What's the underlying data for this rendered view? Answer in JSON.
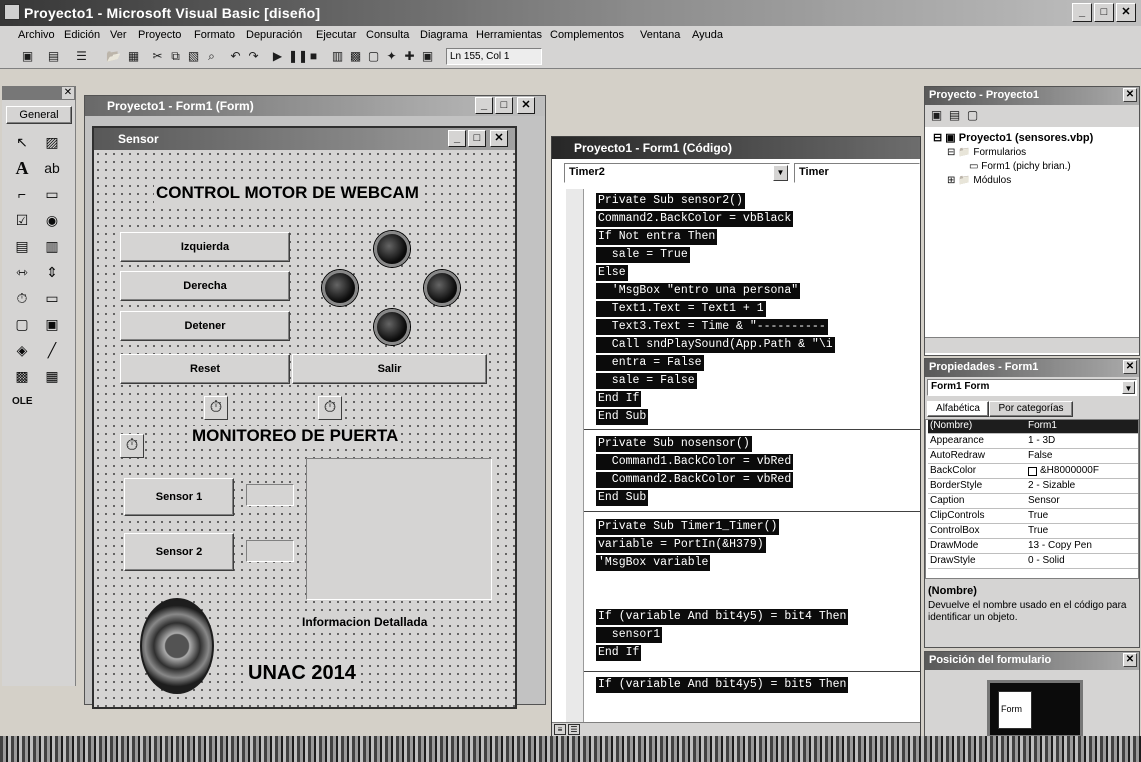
{
  "window": {
    "title": "Proyecto1 - Microsoft Visual Basic [diseño]"
  },
  "menu": [
    "Archivo",
    "Edición",
    "Ver",
    "Proyecto",
    "Formato",
    "Depuración",
    "Ejecutar",
    "Consulta",
    "Diagrama",
    "Herramientas",
    "Complementos",
    "Ventana",
    "Ayuda"
  ],
  "toolbar": {
    "position": "Ln 155, Col 1"
  },
  "toolbox": {
    "title": "General"
  },
  "designer": {
    "title": "Proyecto1 - Form1 (Form)"
  },
  "form": {
    "caption": "Sensor",
    "heading1": "CONTROL MOTOR DE WEBCAM",
    "heading2": "MONITOREO DE PUERTA",
    "buttons": {
      "left": "Izquierda",
      "right": "Derecha",
      "stop": "Detener",
      "reset": "Reset",
      "exit": "Salir",
      "sensor1": "Sensor 1",
      "sensor2": "Sensor 2"
    },
    "info_label": "Informacion Detallada",
    "footer": "UNAC 2014"
  },
  "code": {
    "title": "Proyecto1 - Form1 (Código)",
    "object": "Timer2",
    "procedure": "Timer",
    "lines": [
      "Private Sub sensor2()",
      "Command2.BackColor = vbBlack",
      "If Not entra Then",
      "  sale = True",
      "Else",
      "  'MsgBox \"entro una persona\"",
      "  Text1.Text = Text1 + 1",
      "  Text3.Text = Time & \"----------",
      "  Call sndPlaySound(App.Path & \"\\i",
      "  entra = False",
      "  sale = False",
      "End If",
      "End Sub",
      "Private Sub nosensor()",
      "  Command1.BackColor = vbRed",
      "  Command2.BackColor = vbRed",
      "End Sub",
      "Private Sub Timer1_Timer()",
      "variable = PortIn(&H379)",
      "'MsgBox variable",
      "If (variable And bit4y5) = bit4 Then",
      "  sensor1",
      "End If",
      "If (variable And bit4y5) = bit5 Then"
    ]
  },
  "project": {
    "title": "Proyecto - Proyecto1",
    "root": "Proyecto1 (sensores.vbp)",
    "folder1": "Formularios",
    "form_item": "Form1 (pichy    brian.)",
    "folder2": "Módulos"
  },
  "properties": {
    "title": "Propiedades - Form1",
    "object": "Form1 Form",
    "tab_alpha": "Alfabética",
    "tab_cat": "Por categorías",
    "rows": [
      {
        "name": "(Nombre)",
        "value": "Form1"
      },
      {
        "name": "Appearance",
        "value": "1 - 3D"
      },
      {
        "name": "AutoRedraw",
        "value": "False"
      },
      {
        "name": "BackColor",
        "value": "&H8000000F"
      },
      {
        "name": "BorderStyle",
        "value": "2 - Sizable"
      },
      {
        "name": "Caption",
        "value": "Sensor"
      },
      {
        "name": "ClipControls",
        "value": "True"
      },
      {
        "name": "ControlBox",
        "value": "True"
      },
      {
        "name": "DrawMode",
        "value": "13 - Copy Pen"
      },
      {
        "name": "DrawStyle",
        "value": "0 - Solid"
      }
    ],
    "desc_title": "(Nombre)",
    "desc_text": "Devuelve el nombre usado en el código para identificar un objeto."
  },
  "layout_panel": {
    "title": "Posición del formulario",
    "form_label": "Form"
  }
}
